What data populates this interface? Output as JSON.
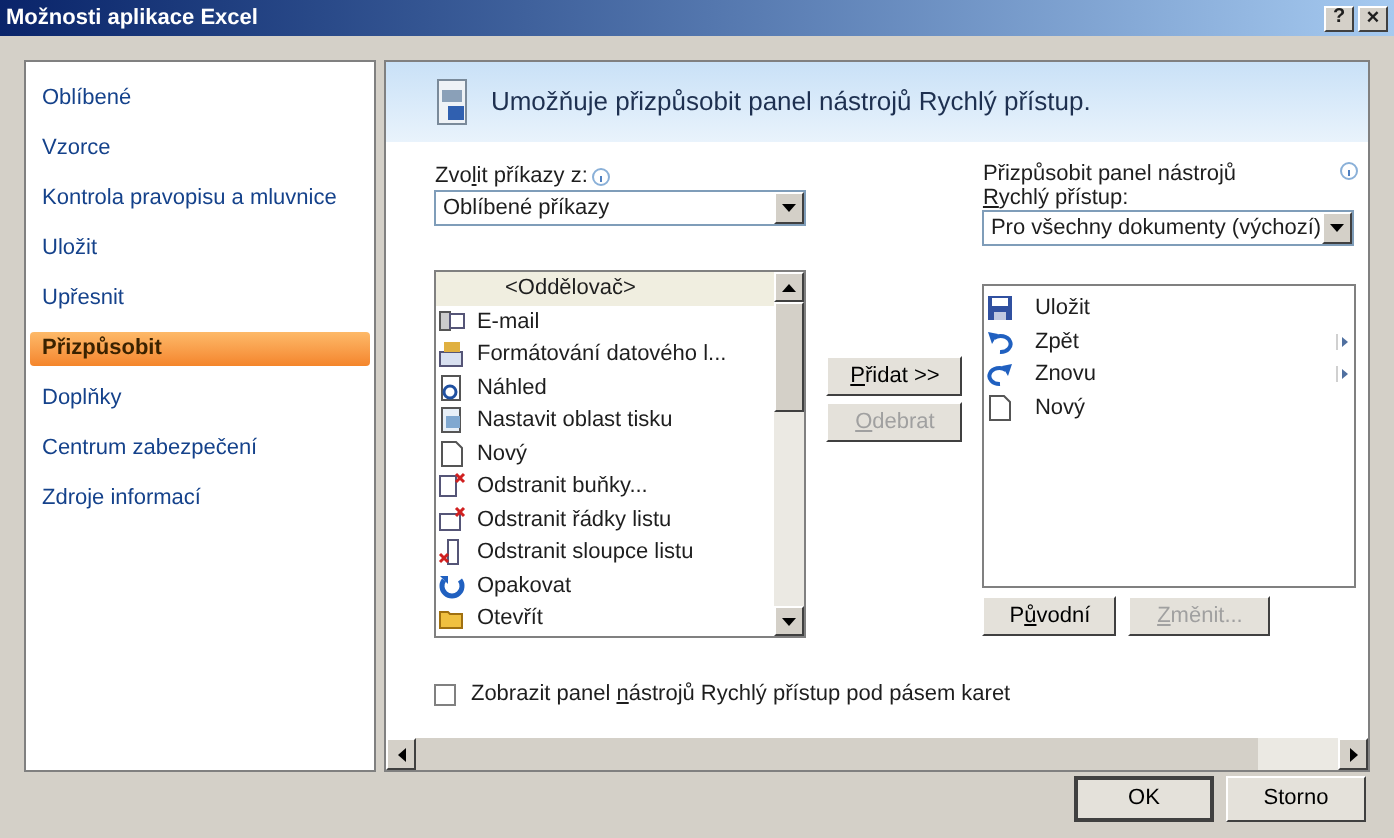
{
  "window": {
    "title": "Možnosti aplikace Excel",
    "help_button": "?",
    "close_button": "×"
  },
  "sidebar": {
    "items": [
      {
        "label": "Oblíbené",
        "selected": false
      },
      {
        "label": "Vzorce",
        "selected": false
      },
      {
        "label": "Kontrola pravopisu a mluvnice",
        "selected": false
      },
      {
        "label": "Uložit",
        "selected": false
      },
      {
        "label": "Upřesnit",
        "selected": false
      },
      {
        "label": "Přizpůsobit",
        "selected": true
      },
      {
        "label": "Doplňky",
        "selected": false
      },
      {
        "label": "Centrum zabezpečení",
        "selected": false
      },
      {
        "label": "Zdroje informací",
        "selected": false
      }
    ]
  },
  "header": {
    "text": "Umožňuje přizpůsobit panel nástrojů Rychlý přístup."
  },
  "choose_commands": {
    "label_parts": {
      "before": "Zvo",
      "key": "l",
      "after": "it příkazy z:"
    },
    "value": "Oblíbené příkazy"
  },
  "commands": [
    {
      "label": "<Oddělovač>",
      "selected": true
    },
    {
      "label": "E-mail",
      "selected": false
    },
    {
      "label": "Formátování datového l...",
      "selected": false
    },
    {
      "label": "Náhled",
      "selected": false
    },
    {
      "label": "Nastavit oblast tisku",
      "selected": false
    },
    {
      "label": "Nový",
      "selected": false
    },
    {
      "label": "Odstranit buňky...",
      "selected": false
    },
    {
      "label": "Odstranit řádky listu",
      "selected": false
    },
    {
      "label": "Odstranit sloupce listu",
      "selected": false
    },
    {
      "label": "Opakovat",
      "selected": false
    },
    {
      "label": "Otevřít",
      "selected": false
    }
  ],
  "add_button": {
    "label_parts": {
      "key": "P",
      "after": "řidat >>"
    },
    "disabled": false
  },
  "remove_button": {
    "label_parts": {
      "key": "O",
      "after": "debrat"
    },
    "disabled": true
  },
  "customize_toolbar": {
    "label_parts": {
      "before": "Přizpůsobit panel nástrojů ",
      "key": "R",
      "after": "ychlý přístup:"
    },
    "value": "Pro všechny dokumenty (výchozí)"
  },
  "toolbar_items": [
    {
      "label": "Uložit",
      "has_submenu": false
    },
    {
      "label": "Zpět",
      "has_submenu": true
    },
    {
      "label": "Znovu",
      "has_submenu": true
    },
    {
      "label": "Nový",
      "has_submenu": false
    }
  ],
  "reset_button": {
    "label_parts": {
      "before": "P",
      "key": "ů",
      "after": "vodní"
    },
    "disabled": false
  },
  "modify_button": {
    "label_parts": {
      "key": "Z",
      "after": "měnit..."
    },
    "disabled": true
  },
  "show_below_ribbon": {
    "label_parts": {
      "before": "Zobrazit panel ",
      "key": "n",
      "after": "ástrojů Rychlý přístup pod pásem karet"
    },
    "checked": false
  },
  "buttons": [
    {
      "label": "OK"
    },
    {
      "label": "Storno"
    }
  ]
}
